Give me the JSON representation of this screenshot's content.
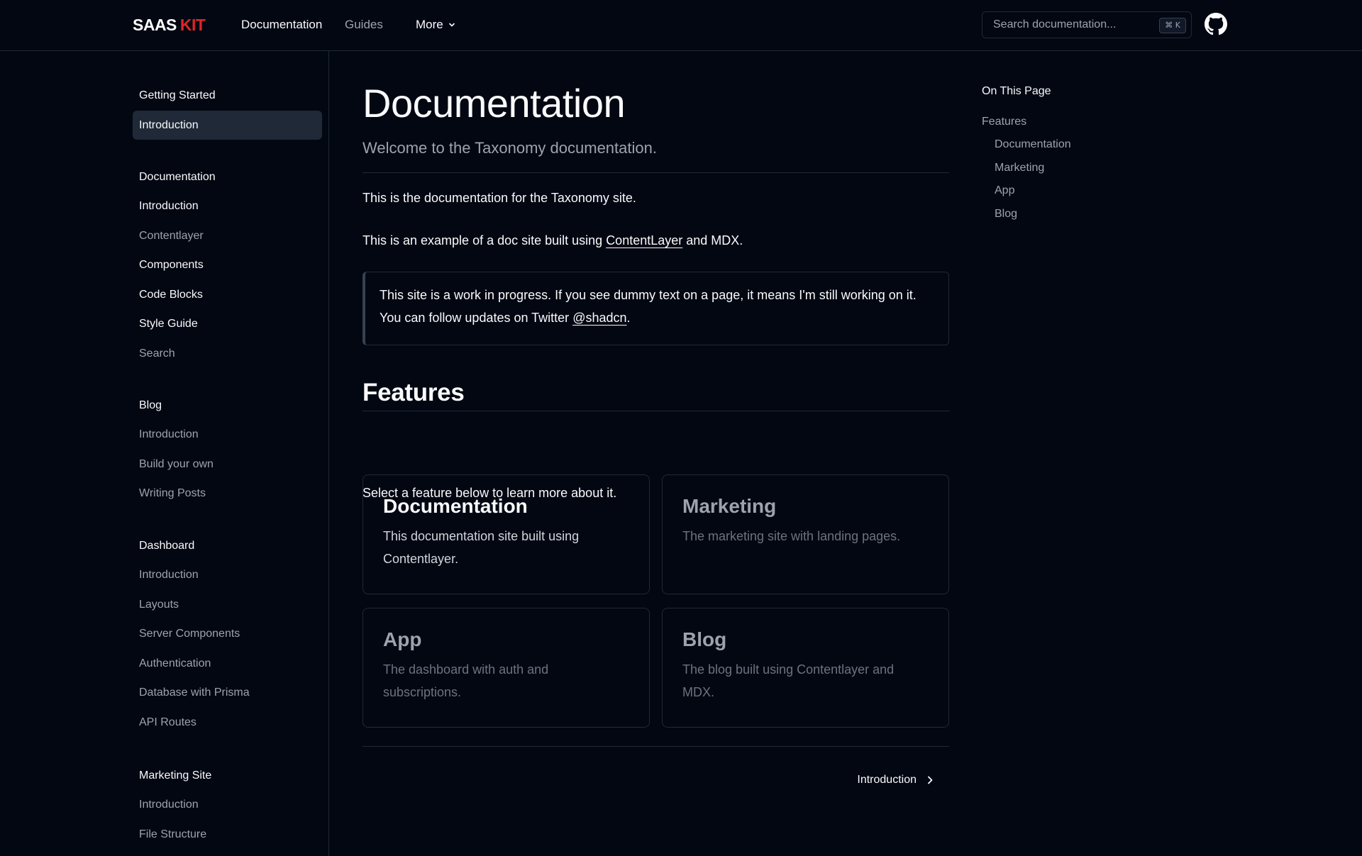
{
  "header": {
    "logo_part1": "SAAS",
    "logo_part2": "KIT",
    "nav": {
      "documentation": "Documentation",
      "guides": "Guides",
      "more": "More"
    },
    "search_placeholder": "Search documentation...",
    "search_shortcut": "⌘ K",
    "github_icon": "github-icon"
  },
  "sidebar": {
    "groups": [
      {
        "title": "Getting Started",
        "items": [
          {
            "label": "Introduction",
            "state": "active"
          }
        ]
      },
      {
        "title": "Documentation",
        "items": [
          {
            "label": "Introduction",
            "state": "on"
          },
          {
            "label": "Contentlayer",
            "state": "off"
          },
          {
            "label": "Components",
            "state": "on"
          },
          {
            "label": "Code Blocks",
            "state": "on"
          },
          {
            "label": "Style Guide",
            "state": "on"
          },
          {
            "label": "Search",
            "state": "off"
          }
        ]
      },
      {
        "title": "Blog",
        "items": [
          {
            "label": "Introduction",
            "state": "off"
          },
          {
            "label": "Build your own",
            "state": "off"
          },
          {
            "label": "Writing Posts",
            "state": "off"
          }
        ]
      },
      {
        "title": "Dashboard",
        "items": [
          {
            "label": "Introduction",
            "state": "off"
          },
          {
            "label": "Layouts",
            "state": "off"
          },
          {
            "label": "Server Components",
            "state": "off"
          },
          {
            "label": "Authentication",
            "state": "off"
          },
          {
            "label": "Database with Prisma",
            "state": "off"
          },
          {
            "label": "API Routes",
            "state": "off"
          }
        ]
      },
      {
        "title": "Marketing Site",
        "items": [
          {
            "label": "Introduction",
            "state": "off"
          },
          {
            "label": "File Structure",
            "state": "off"
          }
        ]
      }
    ]
  },
  "main": {
    "title": "Documentation",
    "lead": "Welcome to the Taxonomy documentation.",
    "p1": "This is the documentation for the Taxonomy site.",
    "p2_before": "This is an example of a doc site built using ",
    "p2_link": "ContentLayer",
    "p2_after": " and MDX.",
    "callout_before": "This site is a work in progress. If you see dummy text on a page, it means I'm still working on it. You can follow updates on Twitter ",
    "callout_link": "@shadcn",
    "callout_after": ".",
    "features_title": "Features",
    "features_intro": "Select a feature below to learn more about it.",
    "cards": [
      {
        "title": "Documentation",
        "desc": "This documentation site built using Contentlayer.",
        "style": "bright"
      },
      {
        "title": "Marketing",
        "desc": "The marketing site with landing pages.",
        "style": "muted"
      },
      {
        "title": "App",
        "desc": "The dashboard with auth and subscriptions.",
        "style": "muted"
      },
      {
        "title": "Blog",
        "desc": "The blog built using Contentlayer and MDX.",
        "style": "muted"
      }
    ],
    "next_label": "Introduction"
  },
  "toc": {
    "title": "On This Page",
    "items": [
      {
        "label": "Features",
        "level": 1
      },
      {
        "label": "Documentation",
        "level": 2
      },
      {
        "label": "Marketing",
        "level": 2
      },
      {
        "label": "App",
        "level": 2
      },
      {
        "label": "Blog",
        "level": 2
      }
    ]
  },
  "colors": {
    "background": "#030712",
    "border": "#1f2937",
    "text": "#f9fafb",
    "muted": "#9ca3af",
    "brand_red": "#dc2626"
  }
}
